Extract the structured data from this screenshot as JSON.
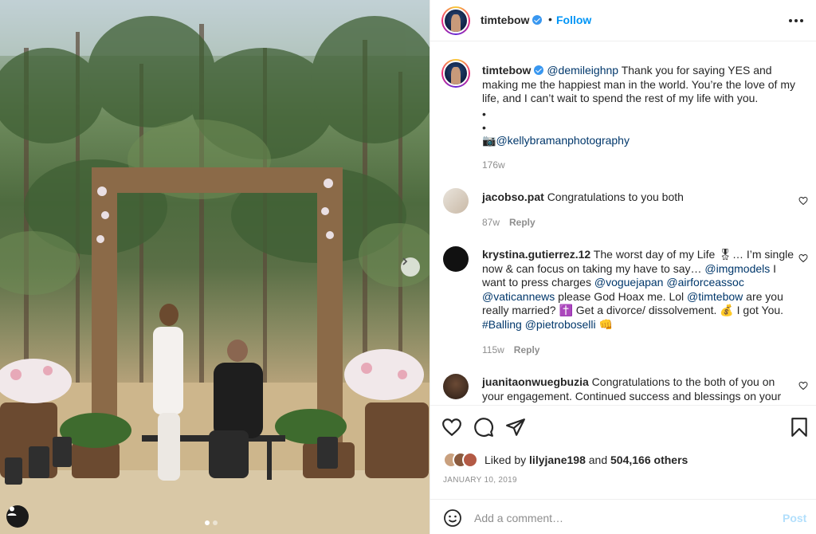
{
  "header": {
    "username": "timtebow",
    "separator": "•",
    "follow_label": "Follow"
  },
  "caption": {
    "username": "timtebow",
    "mention": "@demileighnp",
    "text": " Thank you for saying YES and making me the happiest man in the world. You’re the love of my life, and I can’t wait to spend the rest of my life with you.",
    "bullet1": "•",
    "bullet2": "•",
    "camera": "📷",
    "credit": "@kellybramanphotography",
    "time": "176w"
  },
  "comments": [
    {
      "username": "jacobso.pat",
      "text": "Congratulations to you both",
      "time": "87w",
      "reply": "Reply"
    },
    {
      "username": "krystina.gutierrez.12",
      "p1": " The worst day of my Life 🎖… I’m single now & can focus on taking my have to say…",
      "m1": "@imgmodels",
      "p2": " I want to press charges ",
      "m2": "@voguejapan",
      "m3": "@airforceassoc",
      "m4": "@vaticannews",
      "p3": " please God Hoax me. Lol",
      "m5": "@timtebow",
      "p4": " are you really married? ✝️ Get a divorce/ dissolvement. 💰 I got You. ",
      "m6": "#Balling",
      "m7": "@pietroboselli",
      "p5": " 👊",
      "time": "115w",
      "reply": "Reply"
    },
    {
      "username": "juanitaonwuegbuzia",
      "text": " Congratulations to the both of you on your engagement. Continued success and blessings on your"
    }
  ],
  "actions": {
    "liked_by_prefix": "Liked by ",
    "liked_by_user": "lilyjane198",
    "and": " and ",
    "others": "504,166 others",
    "date": "JANUARY 10, 2019"
  },
  "composer": {
    "placeholder": "Add a comment…",
    "post_label": "Post"
  },
  "colors": {
    "accent": "#0095f6",
    "link": "#00376b",
    "muted": "#8e8e8e"
  }
}
